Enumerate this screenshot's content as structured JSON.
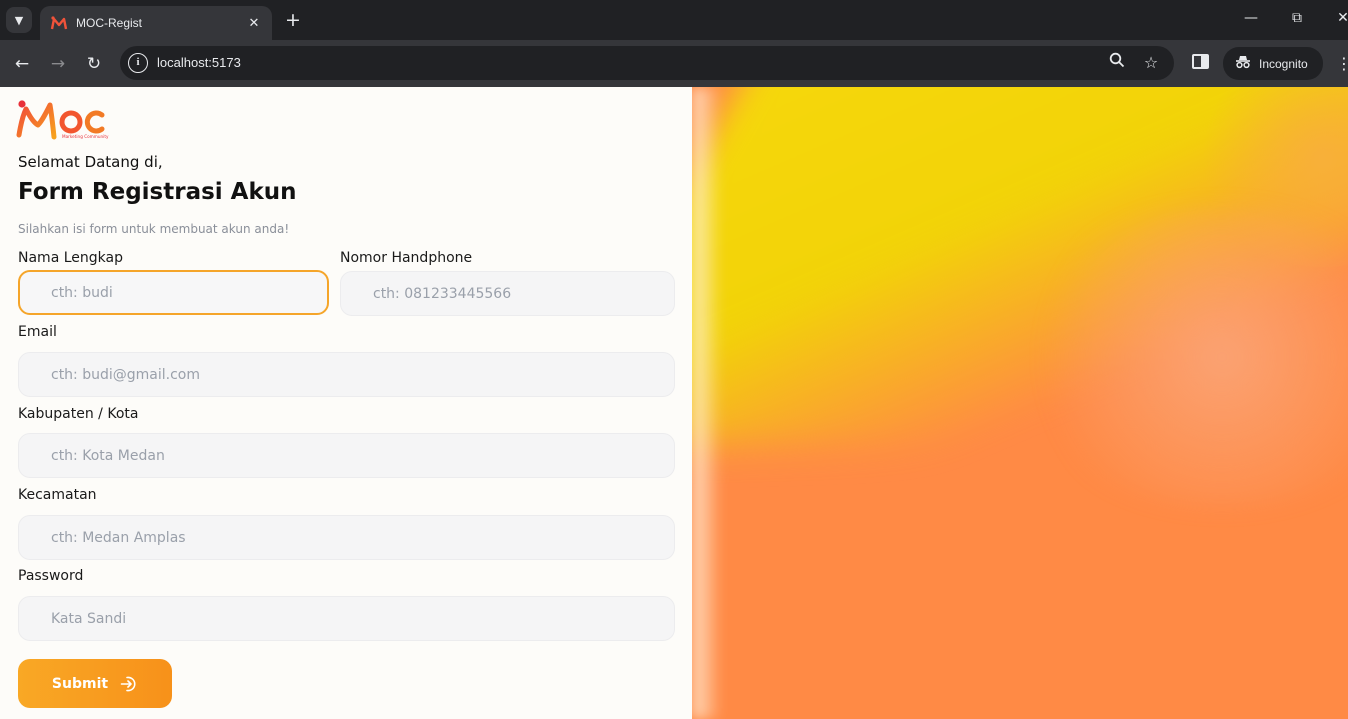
{
  "browser": {
    "tab_title": "MOC-Regist",
    "url": "localhost:5173",
    "incognito_label": "Incognito"
  },
  "logo": {
    "text": "MOC",
    "tagline": "Marketing Community"
  },
  "form": {
    "welcome": "Selamat Datang di,",
    "title": "Form Registrasi Akun",
    "subtitle": "Silahkan isi form untuk membuat akun anda!",
    "fields": [
      {
        "label": "Nama Lengkap",
        "placeholder": "cth: budi",
        "focused": true
      },
      {
        "label": "Nomor Handphone",
        "placeholder": "cth: 081233445566"
      },
      {
        "label": "Email",
        "placeholder": "cth: budi@gmail.com"
      },
      {
        "label": "Kabupaten / Kota",
        "placeholder": "cth: Kota Medan"
      },
      {
        "label": "Kecamatan",
        "placeholder": "cth: Medan Amplas"
      },
      {
        "label": "Password",
        "placeholder": "Kata Sandi"
      }
    ],
    "submit_label": "Submit"
  },
  "colors": {
    "accent": "#f9a825",
    "focus_border": "#f5a52a",
    "hero_yellow": "#f2d308",
    "hero_orange": "#ff8a45"
  }
}
